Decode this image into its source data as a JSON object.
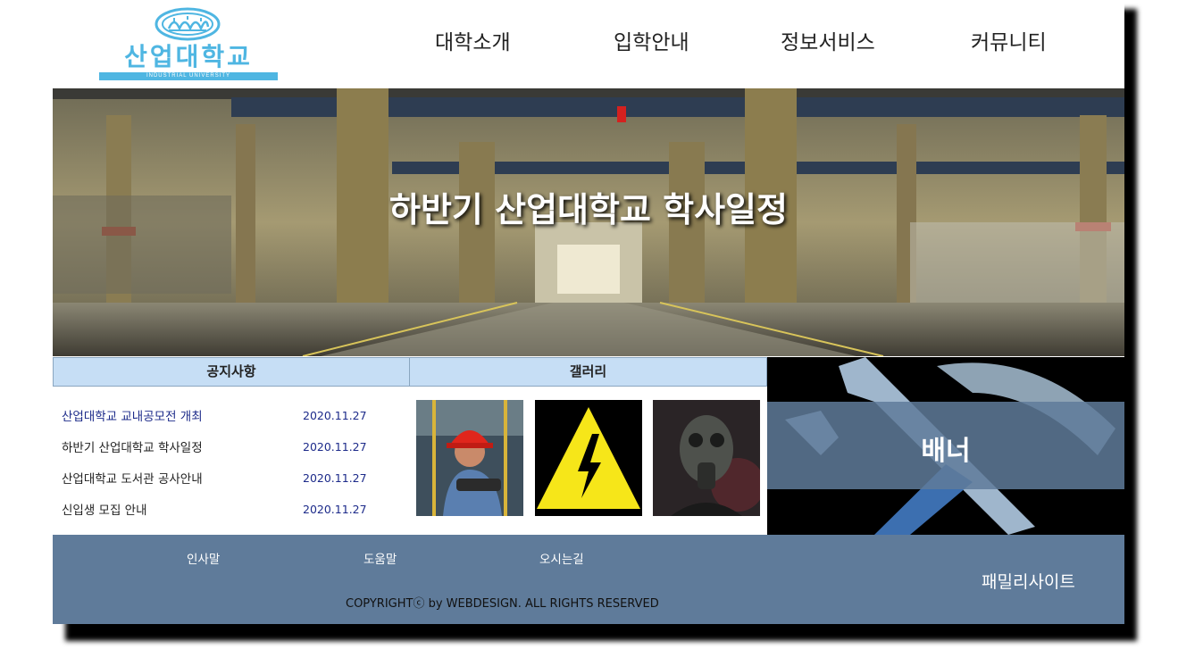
{
  "header": {
    "logo": {
      "text": "산업대학교",
      "subtext": "INDUSTRIAL UNIVERSITY"
    },
    "nav": [
      {
        "label": "대학소개"
      },
      {
        "label": "입학안내"
      },
      {
        "label": "정보서비스"
      },
      {
        "label": "커뮤니티"
      }
    ]
  },
  "hero": {
    "title": "하반기 산업대학교 학사일정"
  },
  "notices": {
    "tab_label": "공지사항",
    "items": [
      {
        "title": "산업대학교 교내공모전 개최",
        "date": "2020.11.27"
      },
      {
        "title": "하반기 산업대학교 학사일정",
        "date": "2020.11.27"
      },
      {
        "title": "산업대학교 도서관 공사안내",
        "date": "2020.11.27"
      },
      {
        "title": "신입생 모집 안내",
        "date": "2020.11.27"
      }
    ]
  },
  "gallery": {
    "tab_label": "갤러리",
    "images": [
      {
        "icon": "worker-photo-icon"
      },
      {
        "icon": "high-voltage-icon"
      },
      {
        "icon": "gas-mask-photo-icon"
      }
    ]
  },
  "banner": {
    "label": "배너"
  },
  "footer": {
    "links": [
      {
        "label": "인사말"
      },
      {
        "label": "도움말"
      },
      {
        "label": "오시는길"
      }
    ],
    "copyright": "COPYRIGHTⓒ by WEBDESIGN. ALL RIGHTS RESERVED",
    "family_site": "패밀리사이트"
  },
  "colors": {
    "accent": "#4fb6e2",
    "tab_bg": "#c6def5",
    "footer_bg": "#5f7b9a",
    "date_text": "#1d2b8a"
  }
}
